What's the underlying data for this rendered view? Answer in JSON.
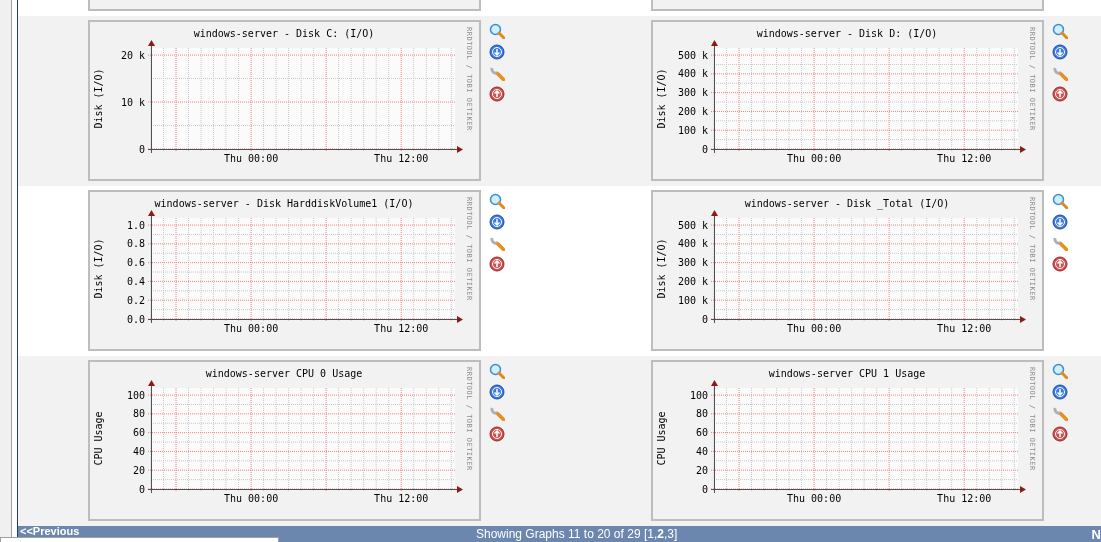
{
  "rows": [
    {
      "graphs": [
        {
          "title": "windows-server - Disk C: (I/O)",
          "ylabel": "Disk (I/O)",
          "y_labels": [
            "20 k",
            "10 k",
            "0"
          ],
          "x_labels": [
            "Thu 00:00",
            "Thu 12:00"
          ],
          "watermark": "RRDTOOL / TOBI OETIKER"
        },
        {
          "title": "windows-server - Disk D: (I/O)",
          "ylabel": "Disk (I/O)",
          "y_labels": [
            "500 k",
            "400 k",
            "300 k",
            "200 k",
            "100 k",
            "0"
          ],
          "x_labels": [
            "Thu 00:00",
            "Thu 12:00"
          ],
          "watermark": "RRDTOOL / TOBI OETIKER"
        }
      ]
    },
    {
      "graphs": [
        {
          "title": "windows-server - Disk HarddiskVolume1 (I/O)",
          "ylabel": "Disk (I/O)",
          "y_labels": [
            "1.0",
            "0.8",
            "0.6",
            "0.4",
            "0.2",
            "0.0"
          ],
          "x_labels": [
            "Thu 00:00",
            "Thu 12:00"
          ],
          "watermark": "RRDTOOL / TOBI OETIKER"
        },
        {
          "title": "windows-server - Disk _Total (I/O)",
          "ylabel": "Disk (I/O)",
          "y_labels": [
            "500 k",
            "400 k",
            "300 k",
            "200 k",
            "100 k",
            "0"
          ],
          "x_labels": [
            "Thu 00:00",
            "Thu 12:00"
          ],
          "watermark": "RRDTOOL / TOBI OETIKER"
        }
      ]
    },
    {
      "graphs": [
        {
          "title": "windows-server CPU 0 Usage",
          "ylabel": "CPU Usage",
          "y_labels": [
            "100",
            "80",
            "60",
            "40",
            "20",
            "0"
          ],
          "x_labels": [
            "Thu 00:00",
            "Thu 12:00"
          ],
          "watermark": "RRDTOOL / TOBI OETIKER"
        },
        {
          "title": "windows-server CPU 1 Usage",
          "ylabel": "CPU Usage",
          "y_labels": [
            "100",
            "80",
            "60",
            "40",
            "20",
            "0"
          ],
          "x_labels": [
            "Thu 00:00",
            "Thu 12:00"
          ],
          "watermark": "RRDTOOL / TOBI OETIKER"
        }
      ]
    }
  ],
  "pager_": {
    "previous": "<<Previous",
    "summary": "Showing Graphs 11 to 20 of 29 [1,**2**,3]",
    "next": "N"
  }
}
